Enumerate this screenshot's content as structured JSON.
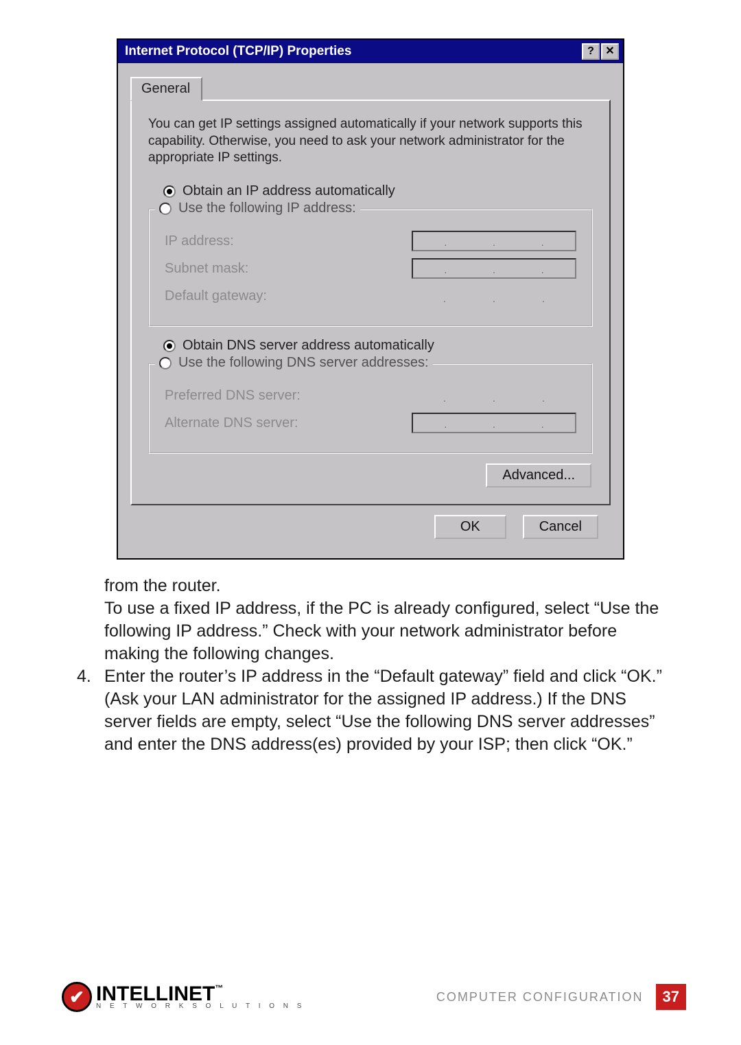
{
  "dialog": {
    "title": "Internet Protocol (TCP/IP) Properties",
    "tab": "General",
    "intro": "You can get IP settings assigned automatically if your network supports this capability. Otherwise, you need to ask your network administrator for the appropriate IP settings.",
    "ip": {
      "auto_label": "Obtain an IP address automatically",
      "manual_label": "Use the following IP address:",
      "fields": {
        "ip_address": "IP address:",
        "subnet_mask": "Subnet mask:",
        "default_gateway": "Default gateway:"
      }
    },
    "dns": {
      "auto_label": "Obtain DNS server address automatically",
      "manual_label": "Use the following DNS server addresses:",
      "fields": {
        "preferred": "Preferred DNS server:",
        "alternate": "Alternate DNS server:"
      }
    },
    "advanced": "Advanced...",
    "ok": "OK",
    "cancel": "Cancel"
  },
  "doc": {
    "line1": "from the router.",
    "para1a": "To use a fixed IP address, if the PC is already configured, select “Use the following IP address.” Check with your network administrator before making the following changes.",
    "step4_num": "4.",
    "step4": "Enter the router’s IP address in the “Default gateway” field and click “OK.” (Ask your LAN administrator for the assigned IP address.) If the DNS server fields are empty, select “Use the following DNS server addresses” and enter the DNS address(es) provided by your ISP; then click “OK.”"
  },
  "footer": {
    "brand_main": "INTELLINET",
    "brand_sub": "N E T W O R K   S O L U T I O N S",
    "section": "COMPUTER CONFIGURATION",
    "page": "37"
  }
}
